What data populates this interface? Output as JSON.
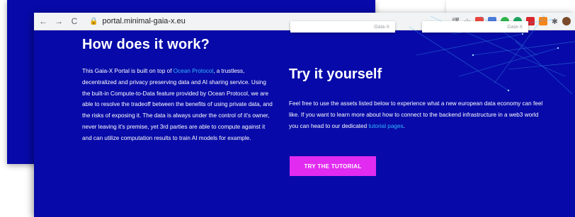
{
  "browser": {
    "url": "portal.minimal-gaia-x.eu",
    "nav": {
      "back": "←",
      "forward": "→",
      "reload": "C"
    }
  },
  "cards": [
    {
      "label": "Gaia-X"
    },
    {
      "label": "Gaia-X"
    }
  ],
  "how": {
    "title": "How does it work?",
    "text_before_link": "This Gaia-X Portal is built on top of ",
    "link": "Ocean Protocol",
    "text_after_link": ", a trustless, decentralized and privacy preserving data and AI sharing service. Using the built-in Compute-to-Data feature provided by Ocean Protocol, we are able to resolve the tradeoff between the benefits of using private data, and the risks of exposing it. The data is always under the control of it's owner, never leaving it's premise, yet 3rd parties are able to compute against it and can utilize computation results to train AI models for example."
  },
  "try": {
    "title": "Try it yourself",
    "text": "Feel free to use the assets listed below to experience what a new european data economy can feel like. If you want to learn more about how to connect to the backend infrastructure in a web3 world you can head to our dedicated ",
    "link": "tutorial pages",
    "text_end": ".",
    "button": "TRY THE TUTORIAL"
  },
  "colors": {
    "background": "#070aa8",
    "accent_button": "#e12bf0",
    "link": "#35b7ff"
  }
}
